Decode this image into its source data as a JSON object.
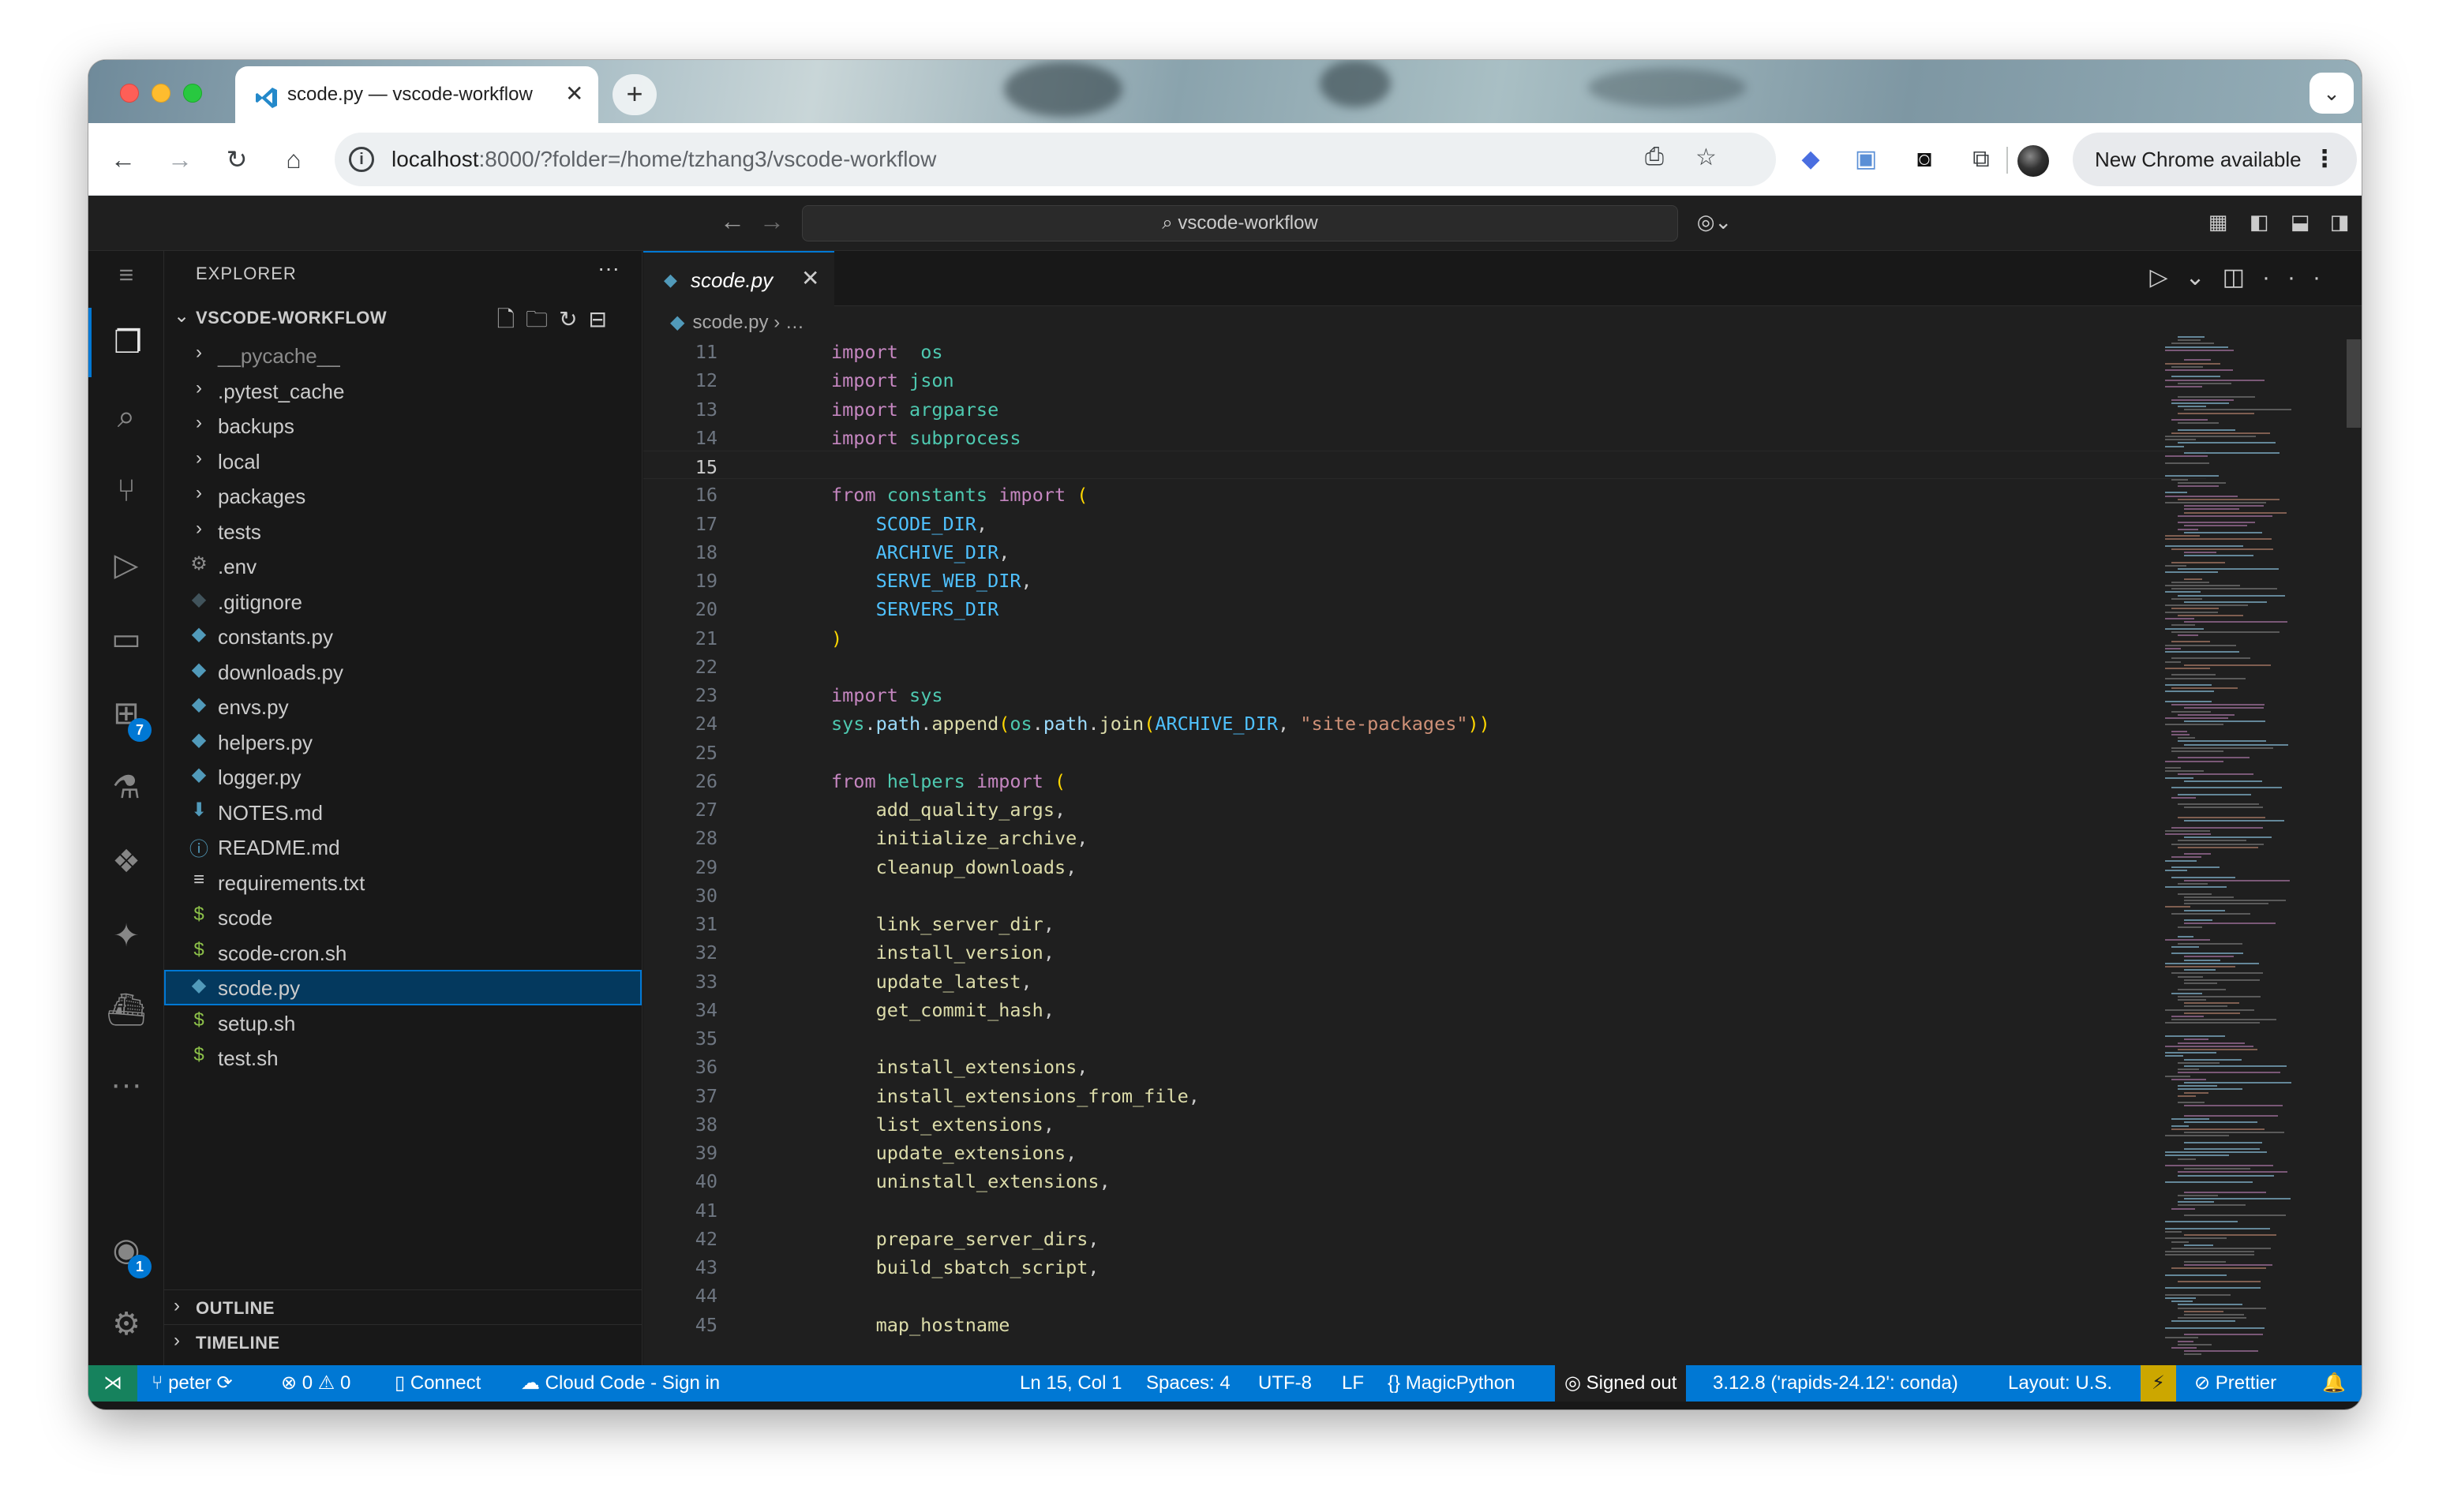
{
  "browser": {
    "tab_title": "scode.py — vscode-workflow",
    "tab_close": "✕",
    "new_tab": "+",
    "url_host": "localhost",
    "url_rest": ":8000/?folder=/home/tzhang3/vscode-workflow",
    "new_chrome_label": "New Chrome available"
  },
  "titlebar": {
    "command_center": "vscode-workflow"
  },
  "activity_bar": {
    "extensions_badge": "7",
    "accounts_badge": "1"
  },
  "explorer": {
    "header": "EXPLORER",
    "workspace": "VSCODE-WORKFLOW",
    "items": [
      {
        "label": "__pycache__",
        "kind": "folder",
        "dim": true
      },
      {
        "label": ".pytest_cache",
        "kind": "folder"
      },
      {
        "label": "backups",
        "kind": "folder"
      },
      {
        "label": "local",
        "kind": "folder"
      },
      {
        "label": "packages",
        "kind": "folder"
      },
      {
        "label": "tests",
        "kind": "folder"
      },
      {
        "label": ".env",
        "kind": "gear-file"
      },
      {
        "label": ".gitignore",
        "kind": "git-file"
      },
      {
        "label": "constants.py",
        "kind": "python-file"
      },
      {
        "label": "downloads.py",
        "kind": "python-file"
      },
      {
        "label": "envs.py",
        "kind": "python-file"
      },
      {
        "label": "helpers.py",
        "kind": "python-file"
      },
      {
        "label": "logger.py",
        "kind": "python-file"
      },
      {
        "label": "NOTES.md",
        "kind": "markdown-file"
      },
      {
        "label": "README.md",
        "kind": "info-file"
      },
      {
        "label": "requirements.txt",
        "kind": "text-file"
      },
      {
        "label": "scode",
        "kind": "shell-file"
      },
      {
        "label": "scode-cron.sh",
        "kind": "shell-file"
      },
      {
        "label": "scode.py",
        "kind": "python-file",
        "selected": true
      },
      {
        "label": "setup.sh",
        "kind": "shell-file"
      },
      {
        "label": "test.sh",
        "kind": "shell-file"
      }
    ],
    "outline": "OUTLINE",
    "timeline": "TIMELINE"
  },
  "editor": {
    "tab_label": "scode.py",
    "breadcrumb_file": "scode.py",
    "breadcrumb_rest": "…",
    "current_line": 15,
    "lines": [
      {
        "n": "11",
        "t": [
          [
            "kw",
            "import"
          ],
          [
            "",
            "  "
          ],
          [
            "mod",
            "os"
          ]
        ]
      },
      {
        "n": "12",
        "t": [
          [
            "kw",
            "import"
          ],
          [
            "",
            " "
          ],
          [
            "mod",
            "json"
          ]
        ]
      },
      {
        "n": "13",
        "t": [
          [
            "kw",
            "import"
          ],
          [
            "",
            " "
          ],
          [
            "mod",
            "argparse"
          ]
        ]
      },
      {
        "n": "14",
        "t": [
          [
            "kw",
            "import"
          ],
          [
            "",
            " "
          ],
          [
            "mod",
            "subprocess"
          ]
        ]
      },
      {
        "n": "15",
        "t": []
      },
      {
        "n": "16",
        "t": [
          [
            "kw",
            "from"
          ],
          [
            "",
            " "
          ],
          [
            "mod",
            "constants"
          ],
          [
            "",
            " "
          ],
          [
            "kw",
            "import"
          ],
          [
            "",
            " "
          ],
          [
            "pn",
            "("
          ]
        ]
      },
      {
        "n": "17",
        "t": [
          [
            "",
            "    "
          ],
          [
            "cn",
            "SCODE_DIR"
          ],
          [
            "",
            ","
          ]
        ]
      },
      {
        "n": "18",
        "t": [
          [
            "",
            "    "
          ],
          [
            "cn",
            "ARCHIVE_DIR"
          ],
          [
            "",
            ","
          ]
        ]
      },
      {
        "n": "19",
        "t": [
          [
            "",
            "    "
          ],
          [
            "cn",
            "SERVE_WEB_DIR"
          ],
          [
            "",
            ","
          ]
        ]
      },
      {
        "n": "20",
        "t": [
          [
            "",
            "    "
          ],
          [
            "cn",
            "SERVERS_DIR"
          ]
        ]
      },
      {
        "n": "21",
        "t": [
          [
            "pn",
            ")"
          ]
        ]
      },
      {
        "n": "22",
        "t": []
      },
      {
        "n": "23",
        "t": [
          [
            "kw",
            "import"
          ],
          [
            "",
            " "
          ],
          [
            "mod",
            "sys"
          ]
        ]
      },
      {
        "n": "24",
        "t": [
          [
            "mod",
            "sys"
          ],
          [
            "",
            "."
          ],
          [
            "id",
            "path"
          ],
          [
            "",
            "."
          ],
          [
            "fn",
            "append"
          ],
          [
            "pn",
            "("
          ],
          [
            "mod",
            "os"
          ],
          [
            "",
            "."
          ],
          [
            "id",
            "path"
          ],
          [
            "",
            "."
          ],
          [
            "fn",
            "join"
          ],
          [
            "pn",
            "("
          ],
          [
            "cn",
            "ARCHIVE_DIR"
          ],
          [
            "",
            ", "
          ],
          [
            "str",
            "\"site-packages\""
          ],
          [
            "pn",
            "))"
          ]
        ]
      },
      {
        "n": "25",
        "t": []
      },
      {
        "n": "26",
        "t": [
          [
            "kw",
            "from"
          ],
          [
            "",
            " "
          ],
          [
            "mod",
            "helpers"
          ],
          [
            "",
            " "
          ],
          [
            "kw",
            "import"
          ],
          [
            "",
            " "
          ],
          [
            "pn",
            "("
          ]
        ]
      },
      {
        "n": "27",
        "t": [
          [
            "",
            "    "
          ],
          [
            "fn",
            "add_quality_args"
          ],
          [
            "",
            ","
          ]
        ]
      },
      {
        "n": "28",
        "t": [
          [
            "",
            "    "
          ],
          [
            "fn",
            "initialize_archive"
          ],
          [
            "",
            ","
          ]
        ]
      },
      {
        "n": "29",
        "t": [
          [
            "",
            "    "
          ],
          [
            "fn",
            "cleanup_downloads"
          ],
          [
            "",
            ","
          ]
        ]
      },
      {
        "n": "30",
        "t": []
      },
      {
        "n": "31",
        "t": [
          [
            "",
            "    "
          ],
          [
            "fn",
            "link_server_dir"
          ],
          [
            "",
            ","
          ]
        ]
      },
      {
        "n": "32",
        "t": [
          [
            "",
            "    "
          ],
          [
            "fn",
            "install_version"
          ],
          [
            "",
            ","
          ]
        ]
      },
      {
        "n": "33",
        "t": [
          [
            "",
            "    "
          ],
          [
            "fn",
            "update_latest"
          ],
          [
            "",
            ","
          ]
        ]
      },
      {
        "n": "34",
        "t": [
          [
            "",
            "    "
          ],
          [
            "fn",
            "get_commit_hash"
          ],
          [
            "",
            ","
          ]
        ]
      },
      {
        "n": "35",
        "t": []
      },
      {
        "n": "36",
        "t": [
          [
            "",
            "    "
          ],
          [
            "fn",
            "install_extensions"
          ],
          [
            "",
            ","
          ]
        ]
      },
      {
        "n": "37",
        "t": [
          [
            "",
            "    "
          ],
          [
            "fn",
            "install_extensions_from_file"
          ],
          [
            "",
            ","
          ]
        ]
      },
      {
        "n": "38",
        "t": [
          [
            "",
            "    "
          ],
          [
            "fn",
            "list_extensions"
          ],
          [
            "",
            ","
          ]
        ]
      },
      {
        "n": "39",
        "t": [
          [
            "",
            "    "
          ],
          [
            "fn",
            "update_extensions"
          ],
          [
            "",
            ","
          ]
        ]
      },
      {
        "n": "40",
        "t": [
          [
            "",
            "    "
          ],
          [
            "fn",
            "uninstall_extensions"
          ],
          [
            "",
            ","
          ]
        ]
      },
      {
        "n": "41",
        "t": []
      },
      {
        "n": "42",
        "t": [
          [
            "",
            "    "
          ],
          [
            "fn",
            "prepare_server_dirs"
          ],
          [
            "",
            ","
          ]
        ]
      },
      {
        "n": "43",
        "t": [
          [
            "",
            "    "
          ],
          [
            "fn",
            "build_sbatch_script"
          ],
          [
            "",
            ","
          ]
        ]
      },
      {
        "n": "44",
        "t": []
      },
      {
        "n": "45",
        "t": [
          [
            "",
            "    "
          ],
          [
            "fn",
            "map_hostname"
          ]
        ]
      }
    ]
  },
  "statusbar": {
    "branch": "peter",
    "problems": "⊗ 0 ⚠ 0",
    "connect": "Connect",
    "cloud_code": "Cloud Code - Sign in",
    "cursor": "Ln 15, Col 1",
    "spaces": "Spaces: 4",
    "encoding": "UTF-8",
    "eol": "LF",
    "language": "MagicPython",
    "signed_out": "Signed out",
    "interpreter": "3.12.8 ('rapids-24.12': conda)",
    "layout": "Layout: U.S.",
    "prettier": "Prettier"
  },
  "colors": {
    "accent": "#0078d4",
    "remote": "#16825d",
    "keyword": "#c586c0",
    "module": "#4ec9b0",
    "constant": "#4fc1ff",
    "function": "#dcdcaa",
    "string": "#ce9178"
  }
}
